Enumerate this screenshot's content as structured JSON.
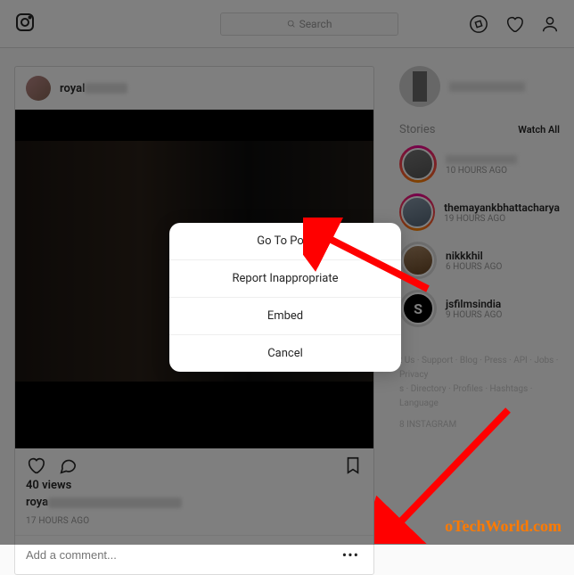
{
  "header": {
    "search_placeholder": "Search"
  },
  "post": {
    "username_prefix": "royal",
    "views": "40 views",
    "caption_prefix": "roya",
    "time": "17 HOURS AGO",
    "comment_placeholder": "Add a comment..."
  },
  "sidebar": {
    "stories_label": "Stories",
    "watch_all": "Watch All",
    "stories": [
      {
        "name": "",
        "time": "10 HOURS AGO",
        "blurred_name": true,
        "ring": "active"
      },
      {
        "name": "themayankbhattacharya",
        "time": "19 HOURS AGO",
        "ring": "active"
      },
      {
        "name": "nikkkhil",
        "time": "6 HOURS AGO",
        "ring": "seen"
      },
      {
        "name": "jsfilmsindia",
        "time": "9 HOURS AGO",
        "ring": "seen",
        "letter": "S"
      }
    ],
    "footer_lines": [
      "t Us · Support · Blog · Press · API · Jobs · Privacy",
      "s · Directory · Profiles · Hashtags · Language"
    ],
    "copyright": "8 INSTAGRAM"
  },
  "modal": {
    "items": [
      "Go To Post",
      "Report Inappropriate",
      "Embed",
      "Cancel"
    ]
  },
  "watermark": "oTechWorld.com"
}
